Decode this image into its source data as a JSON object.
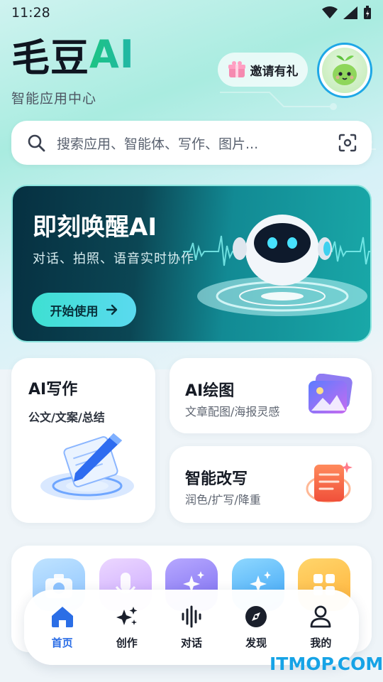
{
  "status_bar": {
    "time": "11:28"
  },
  "header": {
    "logo_cn": "毛豆",
    "logo_ai": "AI",
    "subtitle": "智能应用中心",
    "invite_label": "邀请有礼"
  },
  "search": {
    "placeholder": "搜索应用、智能体、写作、图片..."
  },
  "banner": {
    "title": "即刻唤醒AI",
    "description": "对话、拍照、语音实时协作",
    "button_label": "开始使用"
  },
  "cards": {
    "write": {
      "title": "AI写作",
      "subtitle": "公文/文案/总结"
    },
    "draw": {
      "title": "AI绘图",
      "subtitle": "文章配图/海报灵感"
    },
    "rewrite": {
      "title": "智能改写",
      "subtitle": "润色/扩写/降重"
    }
  },
  "tabbar": {
    "items": [
      {
        "label": "首页",
        "icon": "home-icon",
        "active": true
      },
      {
        "label": "创作",
        "icon": "sparkle-icon",
        "active": false
      },
      {
        "label": "对话",
        "icon": "voice-wave-icon",
        "active": false
      },
      {
        "label": "发现",
        "icon": "compass-icon",
        "active": false
      },
      {
        "label": "我的",
        "icon": "user-icon",
        "active": false
      }
    ]
  },
  "watermark": "ITMOP.COM",
  "colors": {
    "brand_green": "#1fc67e",
    "active_tab": "#2b6ee6",
    "avatar_ring": "#1ea7e6",
    "banner_dark": "#063041"
  }
}
